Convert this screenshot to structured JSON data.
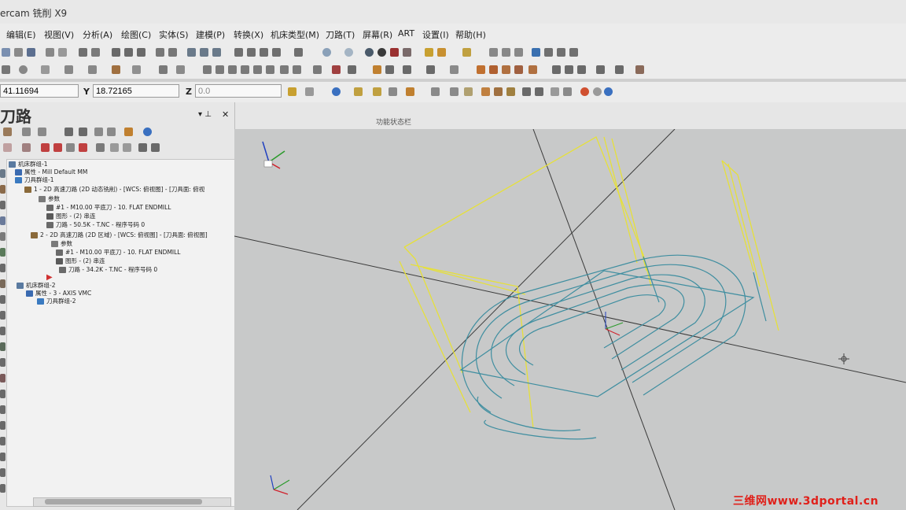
{
  "app": {
    "title": "ercam 铣削 X9"
  },
  "menu": {
    "items": [
      "编辑(E)",
      "视图(V)",
      "分析(A)",
      "绘图(C)",
      "实体(S)",
      "建模(P)",
      "转换(X)",
      "机床类型(M)",
      "刀路(T)",
      "屏幕(R)",
      "ART",
      "设置(I)",
      "帮助(H)"
    ]
  },
  "coords": {
    "x_value": "41.11694",
    "y_label": "Y",
    "y_value": "18.72165",
    "z_label": "Z",
    "z_value": "0.0"
  },
  "ribbon": {
    "status_label": "功能状态栏"
  },
  "manager": {
    "title": "刀路",
    "tree": [
      "机床群组-1",
      "属性 - Mill Default MM",
      "刀具群组-1",
      "1 - 2D 高速刀路 (2D 动态铣削) - [WCS: 俯视图] - [刀具面: 俯视",
      "参数",
      "#1 - M10.00 平底刀 - 10. FLAT ENDMILL",
      "图形 - (2) 串连",
      "刀路 - 50.5K - T.NC - 程序号码 0",
      "2 - 2D 高速刀路 (2D 区域) - [WCS: 俯视图] - [刀具面: 俯视图]",
      "参数",
      "#1 - M10.00 平底刀 - 10. FLAT ENDMILL",
      "图形 - (2) 串连",
      "刀路 - 34.2K - T.NC - 程序号码 0",
      "机床群组-2",
      "属性 - 3 - AXIS VMC",
      "刀具群组-2"
    ]
  },
  "colors": {
    "toolpath_yellow": "#e6e03a",
    "toolpath_teal": "#3f8ea0",
    "axis_x": "#d0202a",
    "axis_y": "#2a9a2a",
    "axis_z": "#2040c0"
  },
  "watermark": {
    "text": "三维网www.3dportal.cn"
  }
}
